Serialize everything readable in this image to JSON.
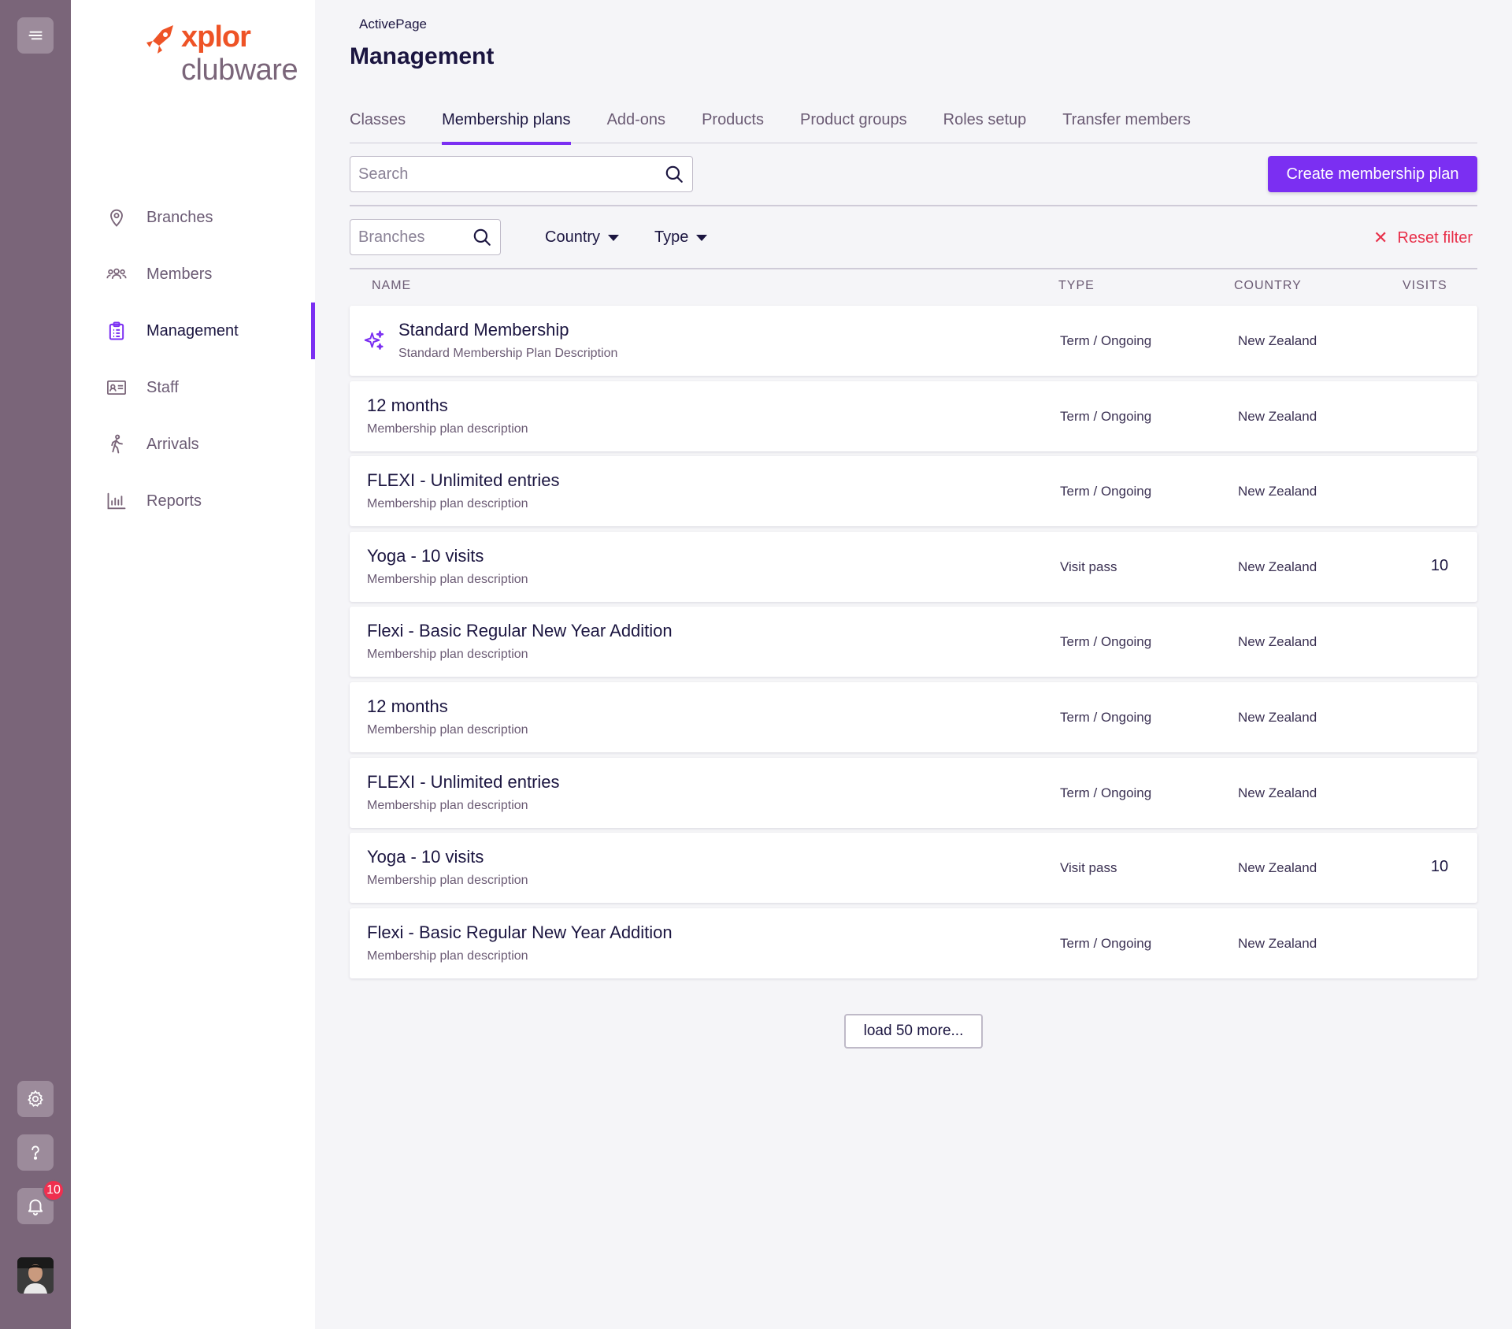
{
  "rail": {
    "notification_count": "10"
  },
  "logo": {
    "line1": "xplor",
    "line2": "clubware"
  },
  "nav": {
    "items": [
      {
        "label": "Branches",
        "icon": "location-pin-icon"
      },
      {
        "label": "Members",
        "icon": "members-icon"
      },
      {
        "label": "Management",
        "icon": "clipboard-icon"
      },
      {
        "label": "Staff",
        "icon": "id-card-icon"
      },
      {
        "label": "Arrivals",
        "icon": "walking-icon"
      },
      {
        "label": "Reports",
        "icon": "bar-chart-icon"
      }
    ],
    "active": "Management"
  },
  "header": {
    "breadcrumb": "ActivePage",
    "title": "Management"
  },
  "tabs": [
    {
      "label": "Classes"
    },
    {
      "label": "Membership plans"
    },
    {
      "label": "Add-ons"
    },
    {
      "label": "Products"
    },
    {
      "label": "Product groups"
    },
    {
      "label": "Roles setup"
    },
    {
      "label": "Transfer members"
    }
  ],
  "toolbar": {
    "search_placeholder": "Search",
    "create_label": "Create membership plan"
  },
  "filters": {
    "branches_placeholder": "Branches",
    "country_label": "Country",
    "type_label": "Type",
    "reset_label": "Reset filter"
  },
  "table": {
    "headers": {
      "name": "NAME",
      "type": "TYPE",
      "country": "COUNTRY",
      "visits": "VISITS"
    },
    "rows": [
      {
        "name": "Standard Membership",
        "description": "Standard Membership Plan Description",
        "type": "Term / Ongoing",
        "country": "New Zealand",
        "visits": "",
        "featured": true
      },
      {
        "name": "12 months",
        "description": "Membership plan description",
        "type": "Term / Ongoing",
        "country": "New Zealand",
        "visits": ""
      },
      {
        "name": "FLEXI - Unlimited entries",
        "description": "Membership plan description",
        "type": "Term / Ongoing",
        "country": "New Zealand",
        "visits": ""
      },
      {
        "name": "Yoga - 10 visits",
        "description": "Membership plan description",
        "type": "Visit pass",
        "country": "New Zealand",
        "visits": "10"
      },
      {
        "name": "Flexi - Basic Regular New Year Addition",
        "description": "Membership plan description",
        "type": "Term / Ongoing",
        "country": "New Zealand",
        "visits": ""
      },
      {
        "name": "12 months",
        "description": "Membership plan description",
        "type": "Term / Ongoing",
        "country": "New Zealand",
        "visits": ""
      },
      {
        "name": "FLEXI - Unlimited entries",
        "description": "Membership plan description",
        "type": "Term / Ongoing",
        "country": "New Zealand",
        "visits": ""
      },
      {
        "name": "Yoga - 10 visits",
        "description": "Membership plan description",
        "type": "Visit pass",
        "country": "New Zealand",
        "visits": "10"
      },
      {
        "name": "Flexi - Basic Regular New Year Addition",
        "description": "Membership plan description",
        "type": "Term / Ongoing",
        "country": "New Zealand",
        "visits": ""
      }
    ]
  },
  "load_more_label": "load 50 more...",
  "colors": {
    "accent": "#7b2ff2",
    "rail": "#7a6579",
    "brand_orange": "#ee5326",
    "danger": "#e8304a"
  }
}
